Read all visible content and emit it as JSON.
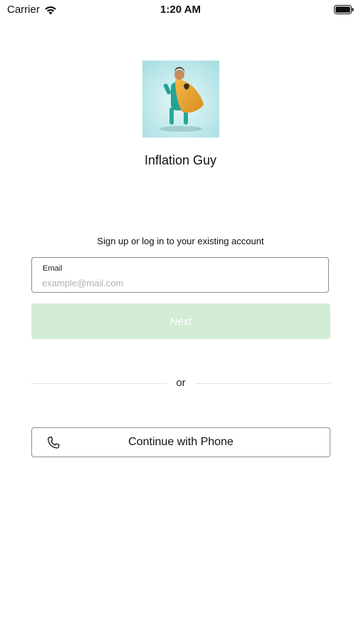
{
  "status_bar": {
    "carrier": "Carrier",
    "time": "1:20 AM",
    "wifi_icon": "wifi-icon",
    "battery_icon": "battery-icon"
  },
  "brand": {
    "logo_icon": "superhero-logo",
    "app_name": "Inflation Guy"
  },
  "auth": {
    "subtitle": "Sign up or log in to your existing account",
    "email": {
      "label": "Email",
      "placeholder": "example@mail.com",
      "value": ""
    },
    "next_label": "Next",
    "divider_text": "or",
    "phone_label": "Continue with Phone",
    "phone_icon": "phone-icon"
  },
  "colors": {
    "next_button_disabled": "#d3ecd4",
    "border": "#8e8e8e",
    "divider": "#e3e3e3"
  }
}
